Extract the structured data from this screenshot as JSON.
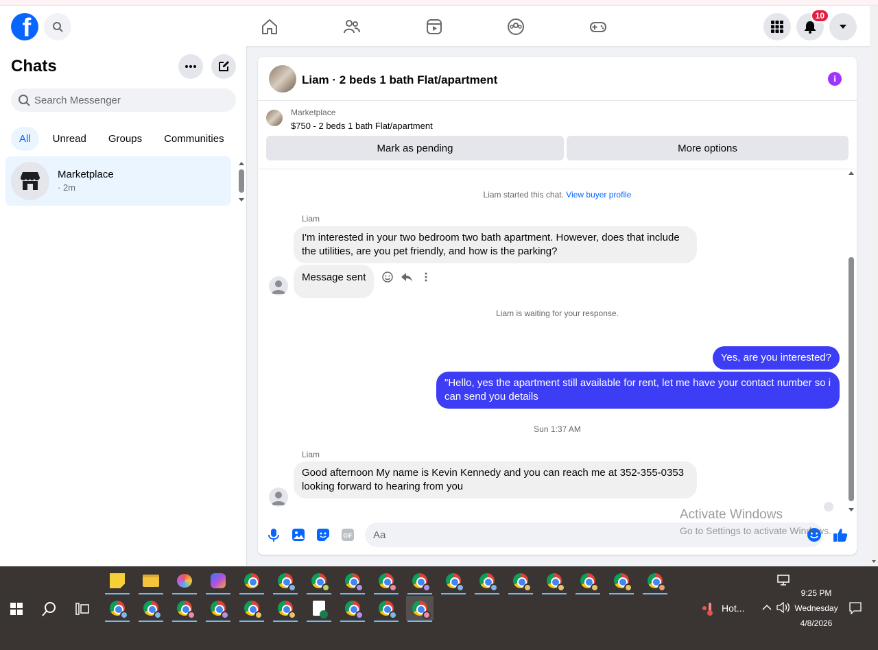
{
  "header": {
    "logo_letter": "f",
    "notification_count": "10"
  },
  "sidebar": {
    "title": "Chats",
    "search_placeholder": "Search Messenger",
    "filters": [
      "All",
      "Unread",
      "Groups",
      "Communities"
    ],
    "active_filter": "All",
    "chats": [
      {
        "name": "Marketplace",
        "time": "· 2m"
      }
    ]
  },
  "conversation": {
    "title": "Liam · 2 beds 1 bath Flat/apartment",
    "marketplace_label": "Marketplace",
    "listing": "$750 - 2 beds 1 bath Flat/apartment",
    "mark_pending_label": "Mark as pending",
    "more_options_label": "More options",
    "started_text": "Liam started this chat.",
    "view_profile_link": "View buyer profile",
    "messages": [
      {
        "sender": "Liam",
        "text": "I'm interested in your two bedroom two bath apartment. However, does that include the utilities, are you pet friendly, and how is the parking?"
      },
      {
        "text": "Message sent"
      },
      {
        "text": "Yes, are you interested?"
      },
      {
        "text": "\"Hello, yes the  apartment still available for rent, let me have your contact number so i can send you details"
      },
      {
        "sender": "Liam",
        "text": "Good afternoon My name is Kevin Kennedy and you can reach me at 352-355-0353 looking forward to hearing from you"
      }
    ],
    "waiting_text": "Liam is waiting for your response.",
    "timestamp": "Sun 1:37 AM",
    "composer_placeholder": "Aa"
  },
  "watermark": {
    "line1": "Activate Windows",
    "line2": "Go to Settings to activate Windows."
  },
  "taskbar": {
    "weather": "Hot...",
    "time": "9:25 PM",
    "day": "Wednesday",
    "date": "4/8/2026"
  },
  "colors": {
    "brand": "#0866ff",
    "outgoing_bubble": "#3d3df5",
    "info_icon": "#a033ff",
    "badge": "#e41e3f"
  }
}
